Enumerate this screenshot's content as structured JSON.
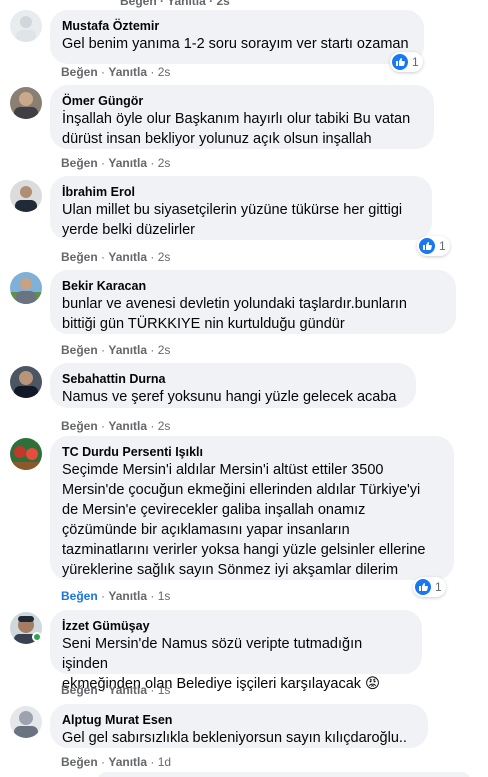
{
  "top_partial": "Beğen · Yanıtla · 2s",
  "common": {
    "like": "Beğen",
    "reply": "Yanıtla"
  },
  "comments": [
    {
      "author": "Mustafa Öztemir",
      "lines": [
        "Gel benim yanıma 1-2 soru sorayım ver startı ozaman"
      ],
      "time": "2s",
      "reactions": "1"
    },
    {
      "author": "Ömer Güngör",
      "lines": [
        "İnşallah öyle olur Başkanım hayırlı olur tabiki Bu vatan",
        "dürüst insan bekliyor yolunuz açık olsun inşallah"
      ],
      "time": "2s",
      "reactions": ""
    },
    {
      "author": "İbrahim Erol",
      "lines": [
        "Ulan millet bu siyasetçilerin yüzüne tükürse her gittigi",
        "yerde belki düzelirler"
      ],
      "time": "2s",
      "reactions": "1"
    },
    {
      "author": "Bekir Karacan",
      "lines": [
        "bunlar ve avenesi devletin yolundaki taşlardır.bunların",
        "bittiği gün TÜRKKIYE nin kurtulduğu gündür"
      ],
      "time": "2s",
      "reactions": ""
    },
    {
      "author": "Sebahattin Durna",
      "lines": [
        "Namus ve şeref yoksunu hangi yüzle gelecek acaba"
      ],
      "time": "2s",
      "reactions": ""
    },
    {
      "author": "TC Durdu Persenti Işıklı",
      "lines": [
        "Seçimde Mersin'i aldılar Mersin'i altüst ettiler 3500",
        "Mersin'de çocuğun ekmeğini ellerinden aldılar Türkiye'yi",
        "de Mersin'e çevirecekler galiba inşallah onamız",
        "çözümünde bir açıklamasını yapar insanların",
        "tazminatlarını verirler yoksa hangi yüzle gelsinler ellerine",
        "yüreklerine sağlık sayın Sönmez iyi akşamlar dilerim"
      ],
      "time": "1s",
      "reactions": "1",
      "liked": true
    },
    {
      "author": "İzzet Gümüşay",
      "lines": [
        "Seni Mersin'de Namus sözü veripte tutmadığın işinden",
        "ekmeğinden olan Belediye işçileri karşılayacak 😡"
      ],
      "time": "1s",
      "reactions": ""
    },
    {
      "author": "Alptug Murat Esen",
      "lines": [
        "Gel gel sabırsızlıkla bekleniyorsun sayın kılıçdaroğlu.."
      ],
      "time": "1d",
      "reactions": ""
    }
  ],
  "colors": {
    "bubble": "#f0f2f5",
    "like_blue": "#1877f2",
    "meta_gray": "#65676b",
    "liked_text": "#1b74e4",
    "online": "#31a24c"
  }
}
